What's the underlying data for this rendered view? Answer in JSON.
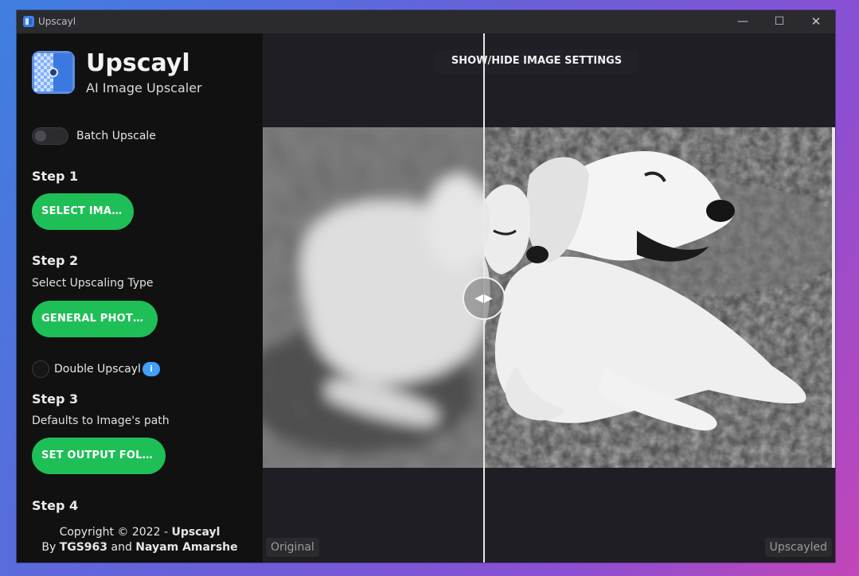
{
  "window": {
    "title": "Upscayl"
  },
  "sidebar": {
    "brand": "Upscayl",
    "tagline": "AI Image Upscaler",
    "batch_label": "Batch Upscale",
    "step1": {
      "title": "Step 1",
      "button": "SELECT IMAGE"
    },
    "step2": {
      "title": "Step 2",
      "subtitle": "Select Upscaling Type",
      "button": "GENERAL PHOTO (...",
      "double_label": "Double Upscayl",
      "info": "i"
    },
    "step3": {
      "title": "Step 3",
      "subtitle": "Defaults to Image's path",
      "button": "SET OUTPUT FOLDER"
    },
    "step4": {
      "title": "Step 4"
    },
    "footer": {
      "line1_prefix": "Copyright © 2022 - ",
      "line1_bold": "Upscayl",
      "line2_prefix": "By ",
      "author1": "TGS963",
      "and": " and ",
      "author2": "Nayam Amarshe"
    }
  },
  "main": {
    "settings_button": "SHOW/HIDE IMAGE SETTINGS",
    "slider_glyph": "◀▶",
    "label_left": "Original",
    "label_right": "Upscayled"
  },
  "colors": {
    "accent_green": "#1fbf57",
    "info_blue": "#3fa0ff",
    "sidebar_bg": "#121111",
    "main_bg": "#1f1e24"
  },
  "icons": [
    "app-logo-icon",
    "minimize-icon",
    "maximize-icon",
    "close-icon",
    "info-icon",
    "compare-slider-icon"
  ]
}
